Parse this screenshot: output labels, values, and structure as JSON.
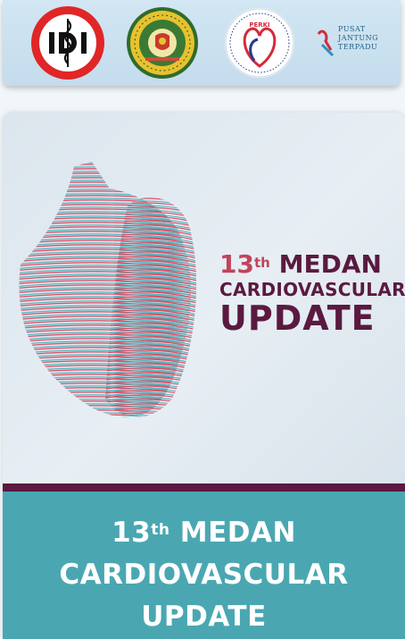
{
  "header": {
    "logos": [
      {
        "name": "IDI",
        "icon": "idi-logo-icon",
        "text": "IDI"
      },
      {
        "name": "Universitas Sumatera Utara",
        "icon": "usu-seal-icon",
        "text": "UNIVERSITAS SUMATERA UTARA"
      },
      {
        "name": "PERKI",
        "icon": "perki-logo-icon",
        "text": "PERKI"
      },
      {
        "name": "Pusat Jantung Terpadu",
        "icon": "pjt-logo-icon",
        "text_lines": [
          "PUSAT",
          "JANTUNG",
          "TERPADU"
        ]
      }
    ]
  },
  "event": {
    "artwork": {
      "number": "13",
      "suffix": "th",
      "word1": "MEDAN",
      "line2": "CARDIOVASCULAR",
      "line3": "UPDATE",
      "icon": "heart-line-art-icon"
    },
    "banner": {
      "number": "13",
      "suffix": "th",
      "word1": "MEDAN",
      "line2": "CARDIOVASCULAR",
      "line3": "UPDATE"
    }
  },
  "colors": {
    "banner_bg": "#4aa7b2",
    "stripe": "#5b1840",
    "title_plum": "#5a1a40",
    "accent_red": "#c4435a",
    "heart_teal": "#4fb3bd",
    "heart_red": "#d9435a",
    "idi_red": "#e02626"
  }
}
